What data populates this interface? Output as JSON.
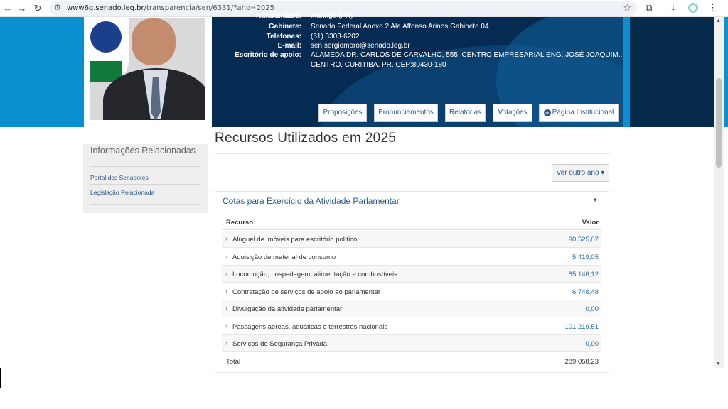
{
  "browser": {
    "back_icon": "arrow-left-icon",
    "forward_icon": "arrow-right-icon",
    "reload_icon": "reload-icon",
    "url_host": "www6g.senado.leg.br",
    "url_path": "/transparencia/sen/6331/?ano=2025"
  },
  "profile": {
    "rows": [
      {
        "label": "Naturalidade:",
        "value": "Maringá (PR)"
      },
      {
        "label": "Gabinete:",
        "value": "Senado Federal Anexo 2 Ala Affonso Arinos Gabinete 04"
      },
      {
        "label": "Telefones:",
        "value": "(61) 3303-6202"
      },
      {
        "label": "E-mail:",
        "value": "sen.sergiomoro@senado.leg.br"
      },
      {
        "label": "Escritório de apoio:",
        "value": "ALAMEDA DR. CARLOS DE CARVALHO, 555. CENTRO EMPRESARIAL ENG. JOSÉ JOAQUIM.."
      },
      {
        "label": "",
        "value": "CENTRO, CURITIBA, PR. CEP:80430-180"
      }
    ],
    "buttons": [
      "Proposições",
      "Pronunciamentos",
      "Relatorias",
      "Votações",
      "Página Institucional"
    ]
  },
  "sidebar": {
    "title": "Informações Relacionadas",
    "links": [
      "Portal dos Senadores",
      "Legislação Relacionada"
    ]
  },
  "main": {
    "title": "Recursos Utilizados em 2025",
    "year_button": "Ver outro ano",
    "panel_title": "Cotas para Exercício da Atividade Parlamentar",
    "table": {
      "headers": [
        "Recurso",
        "Valor"
      ],
      "rows": [
        {
          "label": "Aluguel de imóveis para escritório político",
          "value": "90.525,07"
        },
        {
          "label": "Aquisição de material de consumo",
          "value": "5.419,05"
        },
        {
          "label": "Locomoção, hospedagem, alimentação e combustíveis",
          "value": "85.146,12"
        },
        {
          "label": "Contratação de serviços de apoio ao parlamentar",
          "value": "6.748,48"
        },
        {
          "label": "Divulgação da atividade parlamentar",
          "value": "0,00"
        },
        {
          "label": "Passagens aéreas, aquáticas e terrestres nacionais",
          "value": "101.219,51"
        },
        {
          "label": "Serviços de Segurança Privada",
          "value": "0,00"
        }
      ],
      "total_label": "Total",
      "total_value": "289.058,23"
    }
  }
}
